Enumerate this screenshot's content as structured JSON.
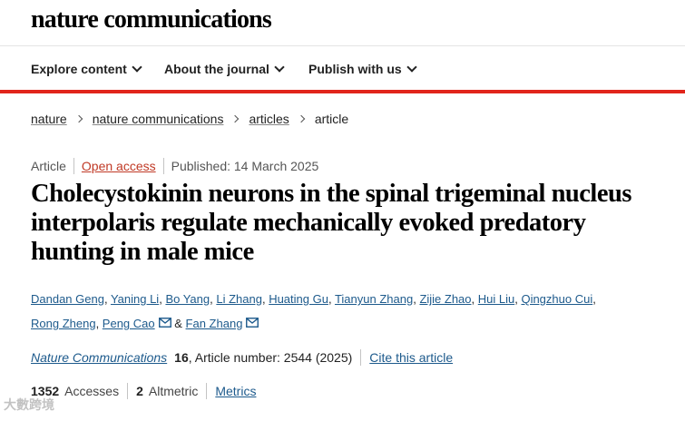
{
  "header": {
    "logo": "nature communications"
  },
  "nav": {
    "items": [
      {
        "label": "Explore content"
      },
      {
        "label": "About the journal"
      },
      {
        "label": "Publish with us"
      }
    ]
  },
  "breadcrumb": {
    "items": [
      "nature",
      "nature communications",
      "articles"
    ],
    "current": "article"
  },
  "article": {
    "type": "Article",
    "access": "Open access",
    "published": "Published: 14 March 2025",
    "title": "Cholecystokinin neurons in the spinal trigeminal nucleus interpolaris regulate mechanically evoked predatory hunting in male mice",
    "authors": [
      "Dandan Geng",
      "Yaning Li",
      "Bo Yang",
      "Li Zhang",
      "Huating Gu",
      "Tianyun Zhang",
      "Zijie Zhao",
      "Hui Liu",
      "Qingzhuo Cui",
      "Rong Zheng",
      "Peng Cao",
      "Fan Zhang"
    ],
    "author_and": "&",
    "journal": "Nature Communications",
    "volume": "16",
    "article_number": ", Article number: 2544 (2025)",
    "cite_label": "Cite this article",
    "accesses_count": "1352",
    "accesses_label": "Accesses",
    "altmetric_count": "2",
    "altmetric_label": "Altmetric",
    "metrics_label": "Metrics"
  },
  "watermark": "大數跨境",
  "colors": {
    "accent_red": "#e1251b",
    "link_blue": "#1d5a8c",
    "open_access": "#c03925"
  }
}
